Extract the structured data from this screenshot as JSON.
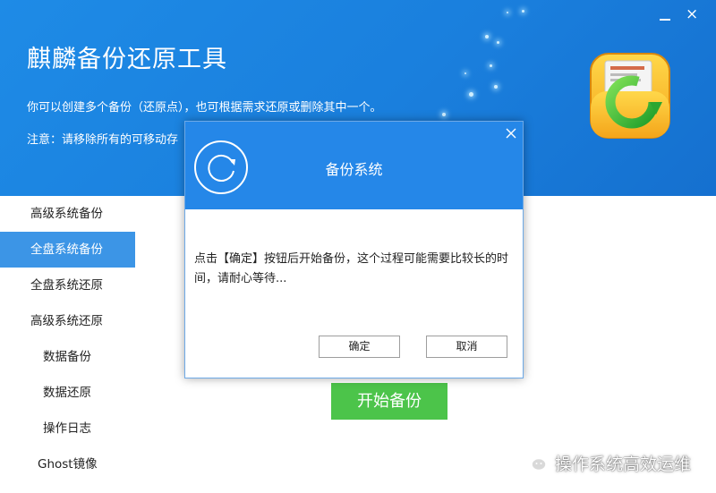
{
  "header": {
    "title": "麒麟备份还原工具",
    "description": "你可以创建多个备份（还原点），也可根据需求还原或删除其中一个。",
    "note": "注意：请移除所有的可移动存",
    "minimize_icon": "minimize-icon",
    "close_label": "×",
    "background_color": "#1e8be6"
  },
  "sidebar": {
    "items": [
      {
        "label": "高级系统备份",
        "active": false
      },
      {
        "label": "全盘系统备份",
        "active": true
      },
      {
        "label": "全盘系统还原",
        "active": false
      },
      {
        "label": "高级系统还原",
        "active": false
      },
      {
        "label": "数据备份",
        "active": false
      },
      {
        "label": "数据还原",
        "active": false
      },
      {
        "label": "操作日志",
        "active": false
      },
      {
        "label": "Ghost镜像",
        "active": false
      }
    ],
    "active_color": "#3c95e6"
  },
  "main": {
    "start_button": "开始备份",
    "start_button_color": "#4cc44a"
  },
  "dialog": {
    "title": "备份系统",
    "message": "点击【确定】按钮后开始备份，这个过程可能需要比较长的时间，请耐心等待...",
    "ok_label": "确定",
    "cancel_label": "取消",
    "header_color": "#2587e8",
    "icon": "refresh-icon"
  },
  "watermark": {
    "text": "操作系统高效运维",
    "icon": "wechat-icon"
  }
}
